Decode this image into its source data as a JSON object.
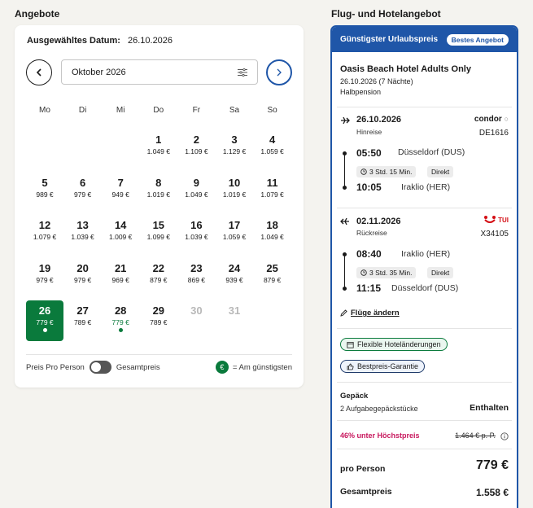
{
  "left_title": "Angebote",
  "right_title": "Flug- und Hotelangebot",
  "calendar": {
    "selected_label": "Ausgewähltes Datum:",
    "selected_value": "26.10.2026",
    "month": "Oktober 2026",
    "weekdays": [
      "Mo",
      "Di",
      "Mi",
      "Do",
      "Fr",
      "Sa",
      "So"
    ],
    "days": [
      {
        "n": "1",
        "p": "1.049 €"
      },
      {
        "n": "2",
        "p": "1.109 €"
      },
      {
        "n": "3",
        "p": "1.129 €"
      },
      {
        "n": "4",
        "p": "1.059 €"
      },
      {
        "n": "5",
        "p": "989 €"
      },
      {
        "n": "6",
        "p": "979 €"
      },
      {
        "n": "7",
        "p": "949 €"
      },
      {
        "n": "8",
        "p": "1.019 €"
      },
      {
        "n": "9",
        "p": "1.049 €"
      },
      {
        "n": "10",
        "p": "1.019 €"
      },
      {
        "n": "11",
        "p": "1.079 €"
      },
      {
        "n": "12",
        "p": "1.079 €"
      },
      {
        "n": "13",
        "p": "1.039 €"
      },
      {
        "n": "14",
        "p": "1.009 €"
      },
      {
        "n": "15",
        "p": "1.099 €"
      },
      {
        "n": "16",
        "p": "1.039 €"
      },
      {
        "n": "17",
        "p": "1.059 €"
      },
      {
        "n": "18",
        "p": "1.049 €"
      },
      {
        "n": "19",
        "p": "979 €"
      },
      {
        "n": "20",
        "p": "979 €"
      },
      {
        "n": "21",
        "p": "969 €"
      },
      {
        "n": "22",
        "p": "879 €"
      },
      {
        "n": "23",
        "p": "869 €"
      },
      {
        "n": "24",
        "p": "939 €"
      },
      {
        "n": "25",
        "p": "879 €"
      },
      {
        "n": "26",
        "p": "779 €",
        "state": "selected"
      },
      {
        "n": "27",
        "p": "789 €"
      },
      {
        "n": "28",
        "p": "779 €",
        "state": "cheap"
      },
      {
        "n": "29",
        "p": "789 €"
      },
      {
        "n": "30",
        "p": "",
        "state": "disabled"
      },
      {
        "n": "31",
        "p": "",
        "state": "disabled"
      }
    ],
    "toggle_left": "Preis Pro Person",
    "toggle_right": "Gesamtpreis",
    "legend_symbol": "€",
    "legend_text": "= Am günstigsten"
  },
  "offer": {
    "header": "Günstigster Urlaubspreis",
    "badge": "Bestes Angebot",
    "hotel": "Oasis Beach Hotel Adults Only",
    "dates": "26.10.2026 (7 Nächte)",
    "board": "Halbpension",
    "outbound": {
      "date": "26.10.2026",
      "label": "Hinreise",
      "airline": "condor",
      "flight": "DE1616",
      "dep_time": "05:50",
      "dep_place": "Düsseldorf (DUS)",
      "duration": "3 Std. 15 Min.",
      "stops": "Direkt",
      "arr_time": "10:05",
      "arr_place": "Iraklio (HER)"
    },
    "inbound": {
      "date": "02.11.2026",
      "label": "Rückreise",
      "airline": "TUI",
      "flight": "X34105",
      "dep_time": "08:40",
      "dep_place": "Iraklio (HER)",
      "duration": "3 Std. 35 Min.",
      "stops": "Direkt",
      "arr_time": "11:15",
      "arr_place": "Düsseldorf (DUS)"
    },
    "change_flights": "Flüge ändern",
    "badge_flex": "Flexible Hoteländerungen",
    "badge_price": "Bestpreis-Garantie",
    "baggage_title": "Gepäck",
    "baggage_desc": "2 Aufgabegepäckstücke",
    "baggage_value": "Enthalten",
    "discount_text": "46% unter Höchstpreis",
    "old_price": "1.464 € p. P.",
    "pp_label": "pro Person",
    "pp_value": "779 €",
    "total_label": "Gesamtpreis",
    "total_value": "1.558 €"
  },
  "colors": {
    "brand_blue": "#1f56a8",
    "cheap_green": "#0a7a3c",
    "discount_pink": "#c8175d",
    "tui_red": "#d40e14"
  }
}
